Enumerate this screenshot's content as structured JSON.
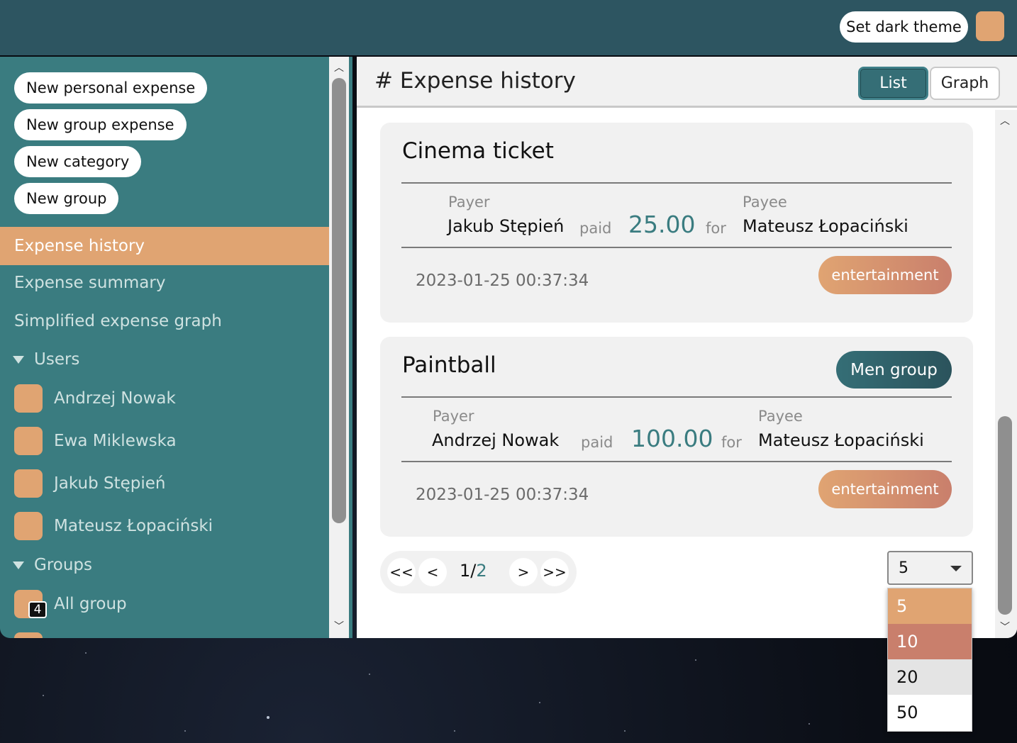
{
  "header": {
    "theme_button": "Set dark theme",
    "theme_swatch_color": "#e0a472"
  },
  "sidebar": {
    "actions": [
      {
        "label": "New personal expense"
      },
      {
        "label": "New group expense"
      },
      {
        "label": "New category"
      },
      {
        "label": "New group"
      }
    ],
    "nav": [
      {
        "label": "Expense history",
        "active": true
      },
      {
        "label": "Expense summary"
      },
      {
        "label": "Simplified expense graph"
      }
    ],
    "users_header": "Users",
    "users": [
      {
        "name": "Andrzej Nowak"
      },
      {
        "name": "Ewa Miklewska"
      },
      {
        "name": "Jakub Stępień"
      },
      {
        "name": "Mateusz Łopaciński"
      }
    ],
    "groups_header": "Groups",
    "groups": [
      {
        "name": "All group",
        "badge": "4"
      }
    ]
  },
  "main": {
    "title": "# Expense history",
    "view_list": "List",
    "view_graph": "Graph",
    "expenses": [
      {
        "title": "Cinema ticket",
        "group": "",
        "payer_label": "Payer",
        "payer": "Jakub Stępień",
        "paid_word": "paid",
        "amount": "25.00",
        "for_word": "for",
        "payee_label": "Payee",
        "payee": "Mateusz Łopaciński",
        "date": "2023-01-25 00:37:34",
        "category": "entertainment"
      },
      {
        "title": "Paintball",
        "group": "Men group",
        "payer_label": "Payer",
        "payer": "Andrzej Nowak",
        "paid_word": "paid",
        "amount": "100.00",
        "for_word": "for",
        "payee_label": "Payee",
        "payee": "Mateusz Łopaciński",
        "date": "2023-01-25 00:37:34",
        "category": "entertainment"
      }
    ],
    "pagination": {
      "first": "<<",
      "prev": "<",
      "current": "1",
      "separator": "/",
      "total": "2",
      "next": ">",
      "last": ">>"
    },
    "page_size": {
      "selected": "5",
      "options": [
        "5",
        "10",
        "20",
        "50"
      ]
    }
  },
  "colors": {
    "accent": "#e0a472",
    "teal": "#3a7c80",
    "topbar": "#2d5561",
    "hover": "#c97f6c"
  }
}
